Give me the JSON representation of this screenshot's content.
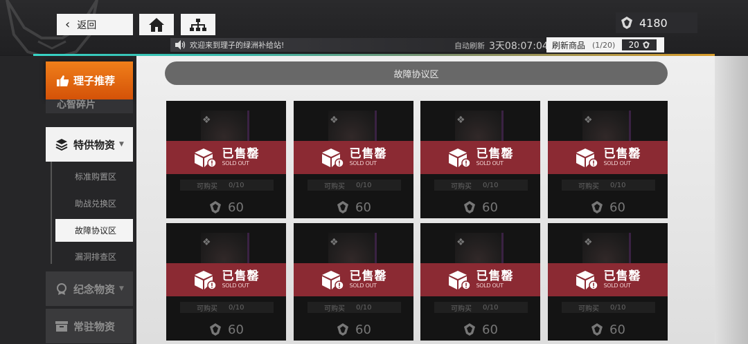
{
  "header": {
    "back_label": "返回",
    "currency_value": "4180",
    "notice": "欢迎来到理子的绿洲补给站!",
    "auto_refresh_label": "自动刷新",
    "auto_refresh_time": "3天08:07:04",
    "refresh_button_label": "刷新商品",
    "refresh_count": "(1/20)",
    "refresh_cost": "20"
  },
  "sidebar": {
    "hot_label": "理子推荐",
    "cut_label": "心智碎片",
    "special_label": "特供物资",
    "sub_items": [
      {
        "label": "标准购置区"
      },
      {
        "label": "助战兑换区"
      },
      {
        "label": "故障协议区"
      },
      {
        "label": "漏洞排查区"
      }
    ],
    "memorial_label": "纪念物资",
    "regular_label": "常驻物资"
  },
  "main": {
    "zone_title": "故障协议区",
    "sold_cn": "已售罄",
    "sold_en": "SOLD OUT",
    "limit_label": "可购买",
    "cards": [
      {
        "limit": "0/10",
        "price": "60"
      },
      {
        "limit": "0/10",
        "price": "60"
      },
      {
        "limit": "0/10",
        "price": "60"
      },
      {
        "limit": "0/10",
        "price": "60"
      },
      {
        "limit": "0/10",
        "price": "60"
      },
      {
        "limit": "0/10",
        "price": "60"
      },
      {
        "limit": "0/10",
        "price": "60"
      },
      {
        "limit": "0/10",
        "price": "60"
      }
    ]
  },
  "colors": {
    "accent_orange": "#e4680f",
    "sold_band": "#8b2a33",
    "progress_start": "#37d4c6",
    "progress_end": "#d79b2a"
  }
}
